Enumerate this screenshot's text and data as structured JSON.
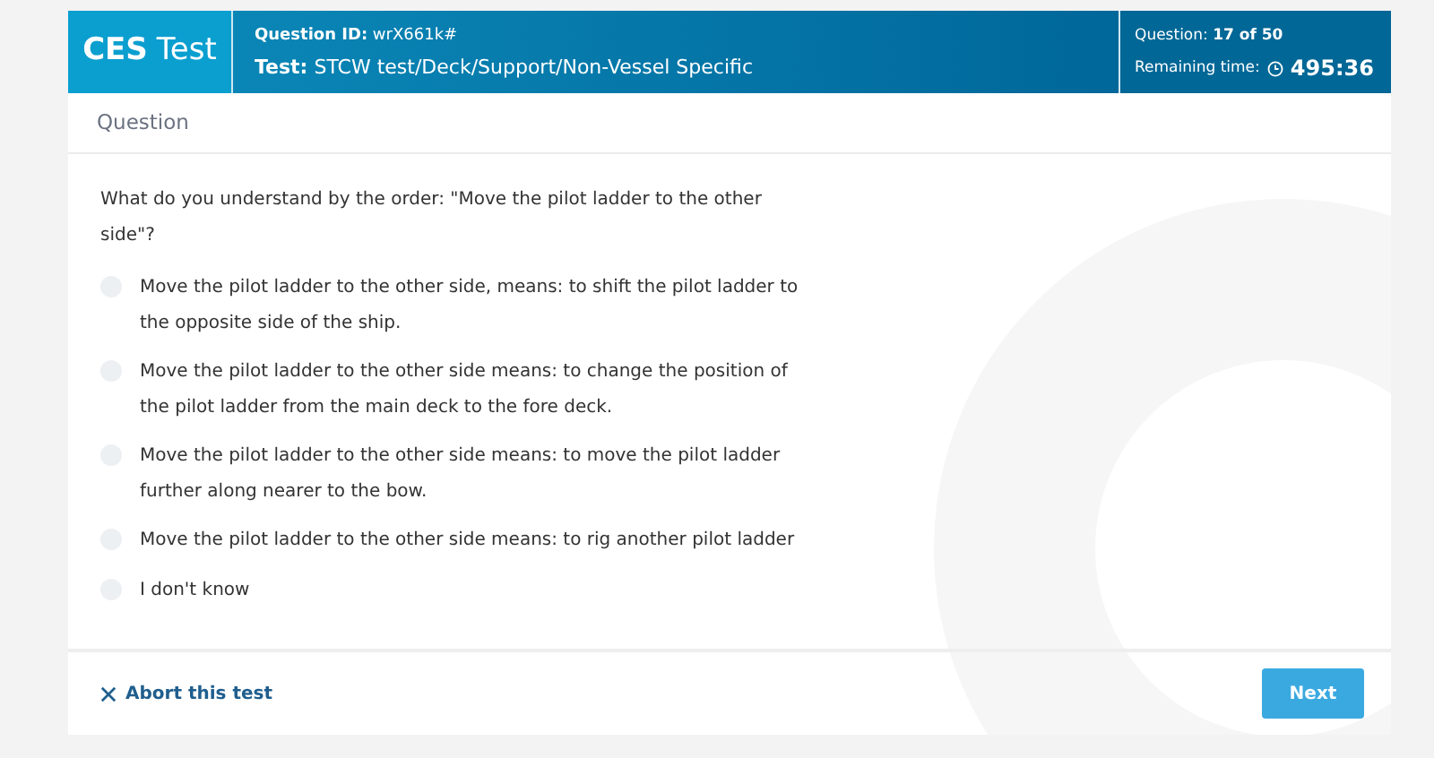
{
  "header": {
    "brand_bold": "CES",
    "brand_light": "Test",
    "question_id_label": "Question ID:",
    "question_id": "wrX661k#",
    "test_label": "Test:",
    "test_path": "STCW test/Deck/Support/Non-Vessel Specific",
    "progress_label": "Question:",
    "progress": "17 of 50",
    "time_label": "Remaining time:",
    "time": "495:36"
  },
  "section_title": "Question",
  "question": "What do you understand by the order: \"Move the pilot ladder to the other side\"?",
  "options": [
    {
      "text": "Move the pilot ladder to the other side, means: to shift the pilot ladder to the opposite side of the ship.",
      "selected": false
    },
    {
      "text": "Move the pilot ladder to the other side means: to change the position of the pilot ladder from the main deck to the fore deck.",
      "selected": false
    },
    {
      "text": "Move the pilot ladder to the other side means: to move the pilot ladder further along nearer to the bow.",
      "selected": false
    },
    {
      "text": "Move the pilot ladder to the other side means: to rig another pilot ladder",
      "selected": false
    },
    {
      "text": "I don't know",
      "selected": false
    }
  ],
  "footer": {
    "abort": "Abort this test",
    "next": "Next"
  }
}
